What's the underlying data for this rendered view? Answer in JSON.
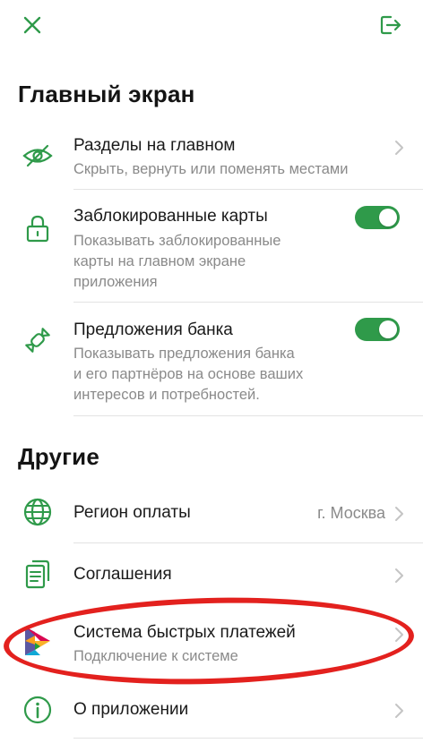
{
  "colors": {
    "accent": "#2f9a4a",
    "highlight": "#e3211e"
  },
  "header": {
    "close_icon": "close-icon",
    "logout_icon": "logout-icon"
  },
  "main_section": {
    "title": "Главный экран",
    "items": [
      {
        "title": "Разделы на главном",
        "subtitle": "Скрыть, вернуть или поменять местами",
        "icon": "eye-off-icon",
        "control": "chevron"
      },
      {
        "title": "Заблокированные карты",
        "subtitle_lines": [
          "Показывать заблокированные",
          "карты на главном экране",
          "приложения"
        ],
        "icon": "lock-icon",
        "control": "toggle",
        "toggle_on": true
      },
      {
        "title": "Предложения банка",
        "subtitle_lines": [
          "Показывать предложения банка",
          "и его партнёров на основе ваших",
          "интересов и потребностей."
        ],
        "icon": "candy-icon",
        "control": "toggle",
        "toggle_on": true
      }
    ]
  },
  "other_section": {
    "title": "Другие",
    "items": [
      {
        "title": "Регион оплаты",
        "value": "г. Москва",
        "icon": "globe-icon",
        "control": "chevron"
      },
      {
        "title": "Соглашения",
        "icon": "documents-icon",
        "control": "chevron"
      },
      {
        "title": "Система быстрых платежей",
        "subtitle": "Подключение к системе",
        "icon": "sbp-logo-icon",
        "control": "chevron"
      },
      {
        "title": "О приложении",
        "icon": "info-icon",
        "control": "chevron"
      }
    ]
  }
}
